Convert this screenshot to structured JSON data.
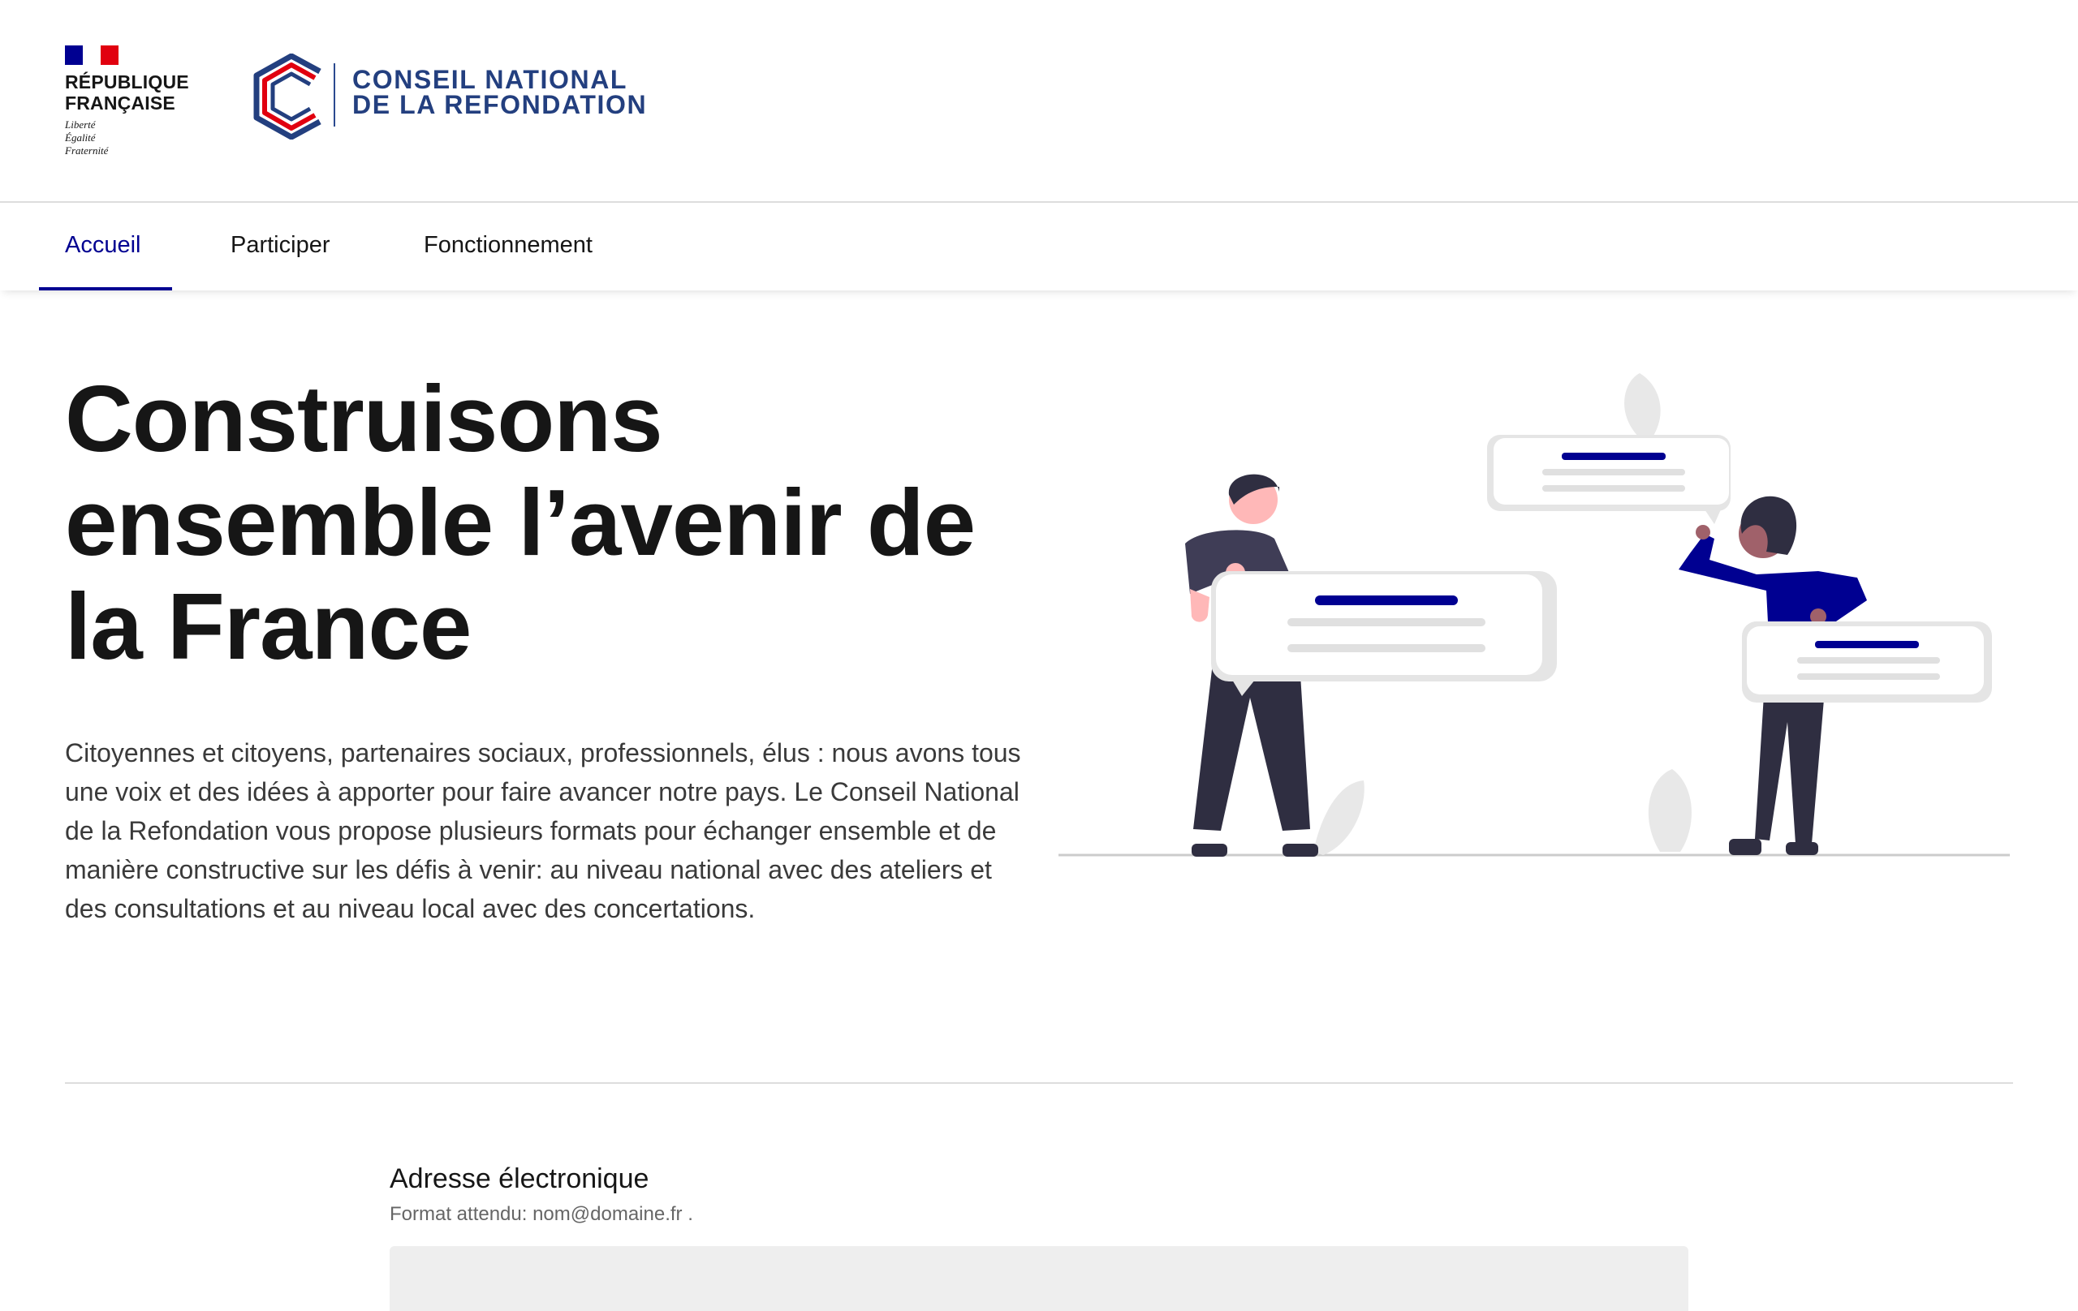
{
  "header": {
    "republique": {
      "line1": "RÉPUBLIQUE",
      "line2": "FRANÇAISE",
      "motto": [
        "Liberté",
        "Égalité",
        "Fraternité"
      ]
    },
    "brand": {
      "line1": "CONSEIL NATIONAL",
      "line2": "DE LA REFONDATION"
    },
    "colors": {
      "flag_blue": "#000091",
      "flag_red": "#e1000f",
      "brand_blue": "#233f7f",
      "brand_red": "#e1000f"
    }
  },
  "nav": {
    "items": [
      {
        "label": "Accueil",
        "active": true
      },
      {
        "label": "Participer",
        "active": false
      },
      {
        "label": "Fonctionnement",
        "active": false
      }
    ]
  },
  "hero": {
    "title": "Construisons ensemble l’avenir de la France",
    "description": "Citoyennes et citoyens, partenaires sociaux, professionnels, élus : nous avons tous une voix et des idées à apporter pour faire avancer notre pays. Le Conseil National de la Refondation vous propose plusieurs formats pour échanger ensemble et de manière constructive sur les défis à venir: au niveau national avec des ateliers et des consultations et au niveau local avec des concertations."
  },
  "form": {
    "email_label": "Adresse électronique",
    "email_hint": "Format attendu: nom@domaine.fr .",
    "email_value": ""
  },
  "theme": {
    "accent": "#000091",
    "text": "#161616",
    "muted": "#666666",
    "input_bg": "#eeeeee"
  }
}
